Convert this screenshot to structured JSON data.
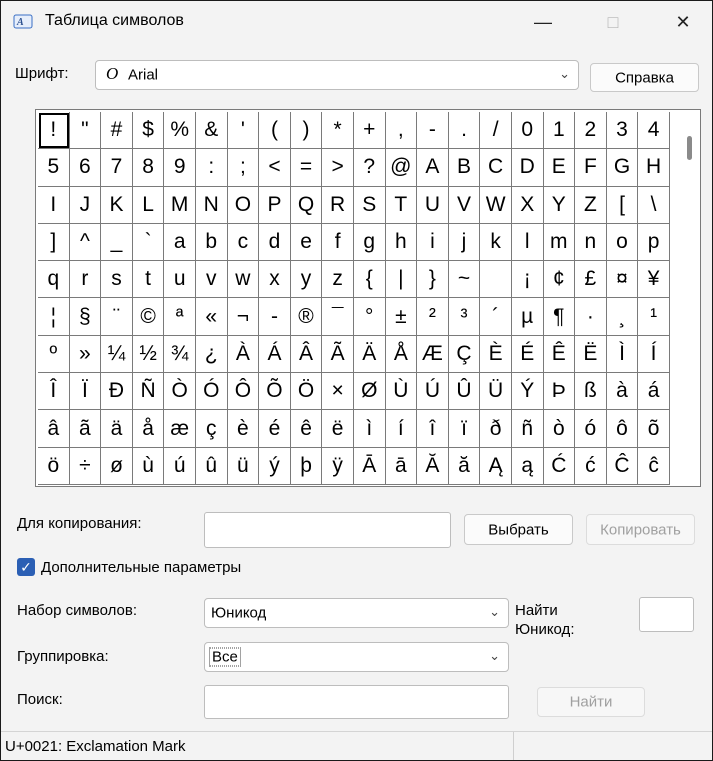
{
  "window": {
    "title": "Таблица символов"
  },
  "font": {
    "label": "Шрифт:",
    "value": "Arial",
    "help_label": "Справка"
  },
  "grid": {
    "selected_index": 0,
    "chars": [
      "!",
      "\"",
      "#",
      "$",
      "%",
      "&",
      "'",
      "(",
      ")",
      "*",
      "+",
      ",",
      "-",
      ".",
      "/",
      "0",
      "1",
      "2",
      "3",
      "4",
      "5",
      "6",
      "7",
      "8",
      "9",
      ":",
      ";",
      "<",
      "=",
      ">",
      "?",
      "@",
      "A",
      "B",
      "C",
      "D",
      "E",
      "F",
      "G",
      "H",
      "I",
      "J",
      "K",
      "L",
      "M",
      "N",
      "O",
      "P",
      "Q",
      "R",
      "S",
      "T",
      "U",
      "V",
      "W",
      "X",
      "Y",
      "Z",
      "[",
      "\\",
      "]",
      "^",
      "_",
      "`",
      "a",
      "b",
      "c",
      "d",
      "e",
      "f",
      "g",
      "h",
      "i",
      "j",
      "k",
      "l",
      "m",
      "n",
      "o",
      "p",
      "q",
      "r",
      "s",
      "t",
      "u",
      "v",
      "w",
      "x",
      "y",
      "z",
      "{",
      "|",
      "}",
      "~",
      " ",
      "¡",
      "¢",
      "£",
      "¤",
      "¥",
      "¦",
      "§",
      "¨",
      "©",
      "ª",
      "«",
      "¬",
      "-",
      "®",
      "¯",
      "°",
      "±",
      "²",
      "³",
      "´",
      "µ",
      "¶",
      "·",
      "¸",
      "¹",
      "º",
      "»",
      "¼",
      "½",
      "¾",
      "¿",
      "À",
      "Á",
      "Â",
      "Ã",
      "Ä",
      "Å",
      "Æ",
      "Ç",
      "È",
      "É",
      "Ê",
      "Ë",
      "Ì",
      "Í",
      "Î",
      "Ï",
      "Ð",
      "Ñ",
      "Ò",
      "Ó",
      "Ô",
      "Õ",
      "Ö",
      "×",
      "Ø",
      "Ù",
      "Ú",
      "Û",
      "Ü",
      "Ý",
      "Þ",
      "ß",
      "à",
      "á",
      "â",
      "ã",
      "ä",
      "å",
      "æ",
      "ç",
      "è",
      "é",
      "ê",
      "ë",
      "ì",
      "í",
      "î",
      "ï",
      "ð",
      "ñ",
      "ò",
      "ó",
      "ô",
      "õ",
      "ö",
      "÷",
      "ø",
      "ù",
      "ú",
      "û",
      "ü",
      "ý",
      "þ",
      "ÿ",
      "Ā",
      "ā",
      "Ă",
      "ă",
      "Ą",
      "ą",
      "Ć",
      "ć",
      "Ĉ",
      "ĉ"
    ]
  },
  "copy": {
    "label": "Для копирования:",
    "value": "",
    "select_label": "Выбрать",
    "copy_label": "Копировать"
  },
  "advanced": {
    "label": "Дополнительные параметры",
    "checked": true
  },
  "charset": {
    "label": "Набор символов:",
    "value": "Юникод"
  },
  "unicode_search": {
    "label_line1": "Найти",
    "label_line2": "Юникод:",
    "value": ""
  },
  "grouping": {
    "label": "Группировка:",
    "value": "Все"
  },
  "search": {
    "label": "Поиск:",
    "value": "",
    "find_label": "Найти"
  },
  "status": {
    "text": "U+0021: Exclamation Mark"
  },
  "icons": {
    "checkbox": "check-icon",
    "chevron": "chevron-down-icon"
  }
}
